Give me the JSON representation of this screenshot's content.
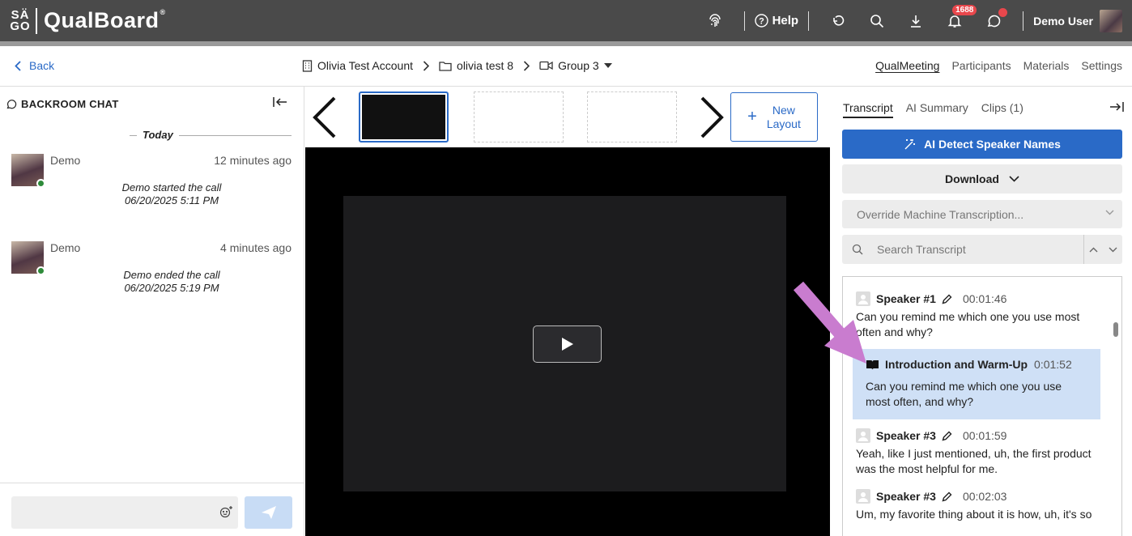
{
  "app": {
    "logo_mark_top": "SÄ",
    "logo_mark_bottom": "GO",
    "name": "QualBoard",
    "registered": "®"
  },
  "topbar": {
    "help_label": "Help",
    "notification_count": "1688",
    "user_name": "Demo User"
  },
  "subheader": {
    "back_label": "Back",
    "breadcrumb": {
      "account": "Olivia Test Account",
      "project": "olivia test 8",
      "group": "Group 3"
    },
    "nav": {
      "qualmeeting": "QualMeeting",
      "participants": "Participants",
      "materials": "Materials",
      "settings": "Settings"
    }
  },
  "backroom": {
    "title": "BACKROOM CHAT",
    "today_label": "Today",
    "messages": [
      {
        "name": "Demo",
        "time": "12 minutes ago",
        "line1": "Demo started the call",
        "line2": "06/20/2025 5:11 PM"
      },
      {
        "name": "Demo",
        "time": "4 minutes ago",
        "line1": "Demo ended the call",
        "line2": "06/20/2025 5:19 PM"
      }
    ],
    "input_placeholder": ""
  },
  "center": {
    "new_layout_line1": "New",
    "new_layout_line2": "Layout"
  },
  "right": {
    "tabs": {
      "transcript": "Transcript",
      "ai_summary": "AI Summary",
      "clips": "Clips (1)"
    },
    "ai_button": "AI Detect Speaker Names",
    "download_button": "Download",
    "override_select": "Override Machine Transcription...",
    "search_placeholder": "Search Transcript",
    "entries": [
      {
        "speaker": "Speaker #1",
        "time": "00:01:46",
        "text": "Can you remind me which one you use most often and why?"
      },
      {
        "speaker": "Speaker #3",
        "time": "00:01:59",
        "text": "Yeah, like I just mentioned, uh, the first product was the most helpful for me."
      },
      {
        "speaker": "Speaker #3",
        "time": "00:02:03",
        "text": "Um, my favorite thing about it is how, uh, it's so"
      }
    ],
    "chapter": {
      "title": "Introduction and Warm-Up",
      "time": "0:01:52",
      "text": "Can you remind me which one you use most often, and why?"
    }
  },
  "colors": {
    "topbar": "#4a4a4a",
    "accent": "#2a6ac7",
    "chapter_highlight": "#cfe0f6",
    "annotation_arrow": "#c97ccf",
    "badge": "#e8474c",
    "online": "#2e8b3a"
  }
}
